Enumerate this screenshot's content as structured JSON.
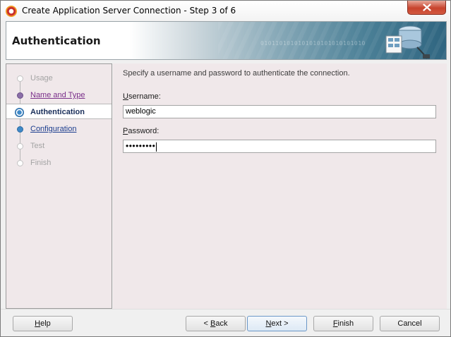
{
  "window": {
    "title": "Create Application Server Connection - Step 3 of 6"
  },
  "header": {
    "title": "Authentication",
    "banner_bits": "0101101010101010101010101010"
  },
  "nav": {
    "items": [
      {
        "label": "Usage",
        "state": "disabled"
      },
      {
        "label": "Name and Type",
        "state": "visited"
      },
      {
        "label": "Authentication",
        "state": "current"
      },
      {
        "label": "Configuration",
        "state": "link"
      },
      {
        "label": "Test",
        "state": "disabled"
      },
      {
        "label": "Finish",
        "state": "disabled"
      }
    ]
  },
  "form": {
    "instruction": "Specify a username and password to authenticate the connection.",
    "username": {
      "label_accel": "U",
      "label_rest": "sername:",
      "value": "weblogic"
    },
    "password": {
      "label_accel": "P",
      "label_rest": "assword:",
      "value": "•••••••••"
    }
  },
  "buttons": {
    "help": {
      "accel": "H",
      "rest": "elp"
    },
    "back": {
      "prefix": "< ",
      "accel": "B",
      "rest": "ack"
    },
    "next": {
      "accel": "N",
      "rest": "ext >"
    },
    "finish": {
      "accel": "F",
      "rest": "inish"
    },
    "cancel": "Cancel"
  },
  "colors": {
    "panel_bg": "#f0e8ea",
    "link": "#1b3d8e",
    "visited": "#7a2f8a",
    "accent": "#3f89c8"
  }
}
